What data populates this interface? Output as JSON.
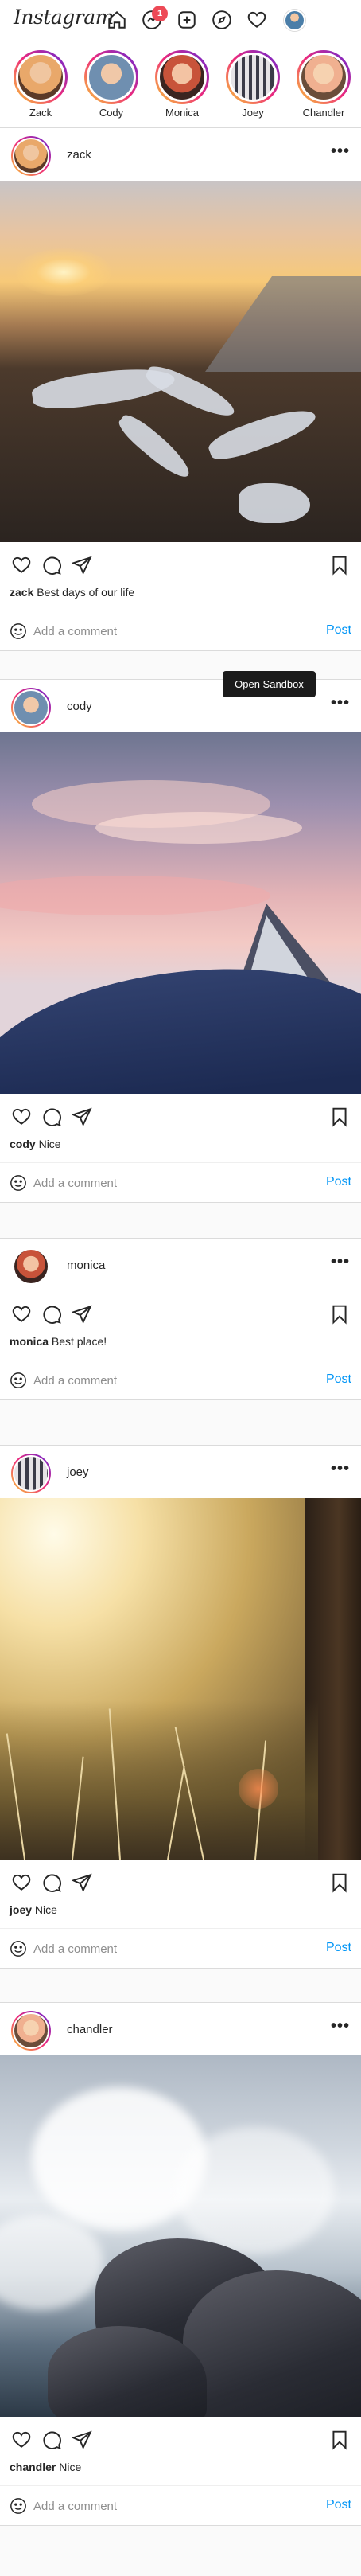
{
  "app": {
    "logo": "Instagram",
    "message_badge": "1"
  },
  "stories": [
    {
      "name": "Zack",
      "colors": [
        "#e9a86a",
        "#5b3a28"
      ]
    },
    {
      "name": "Cody",
      "colors": [
        "#6f8fb0",
        "#f0c8a8"
      ]
    },
    {
      "name": "Monica",
      "colors": [
        "#c8533a",
        "#f3c3a3"
      ]
    },
    {
      "name": "Joey",
      "colors": [
        "#7b7b88",
        "#e6e3e6"
      ]
    },
    {
      "name": "Chandler",
      "colors": [
        "#f0b090",
        "#6a4d3a"
      ]
    }
  ],
  "posts": [
    {
      "username": "zack",
      "caption_user": "zack",
      "caption_text": "Best days of our life"
    },
    {
      "username": "cody",
      "caption_user": "cody",
      "caption_text": "Nice"
    },
    {
      "username": "monica",
      "caption_user": "monica",
      "caption_text": "Best place!"
    },
    {
      "username": "joey",
      "caption_user": "joey",
      "caption_text": "Nice"
    },
    {
      "username": "chandler",
      "caption_user": "chandler",
      "caption_text": "Nice"
    }
  ],
  "comment": {
    "placeholder": "Add a comment",
    "post_label": "Post"
  },
  "more_label": "•••",
  "tooltip": "Open Sandbox"
}
